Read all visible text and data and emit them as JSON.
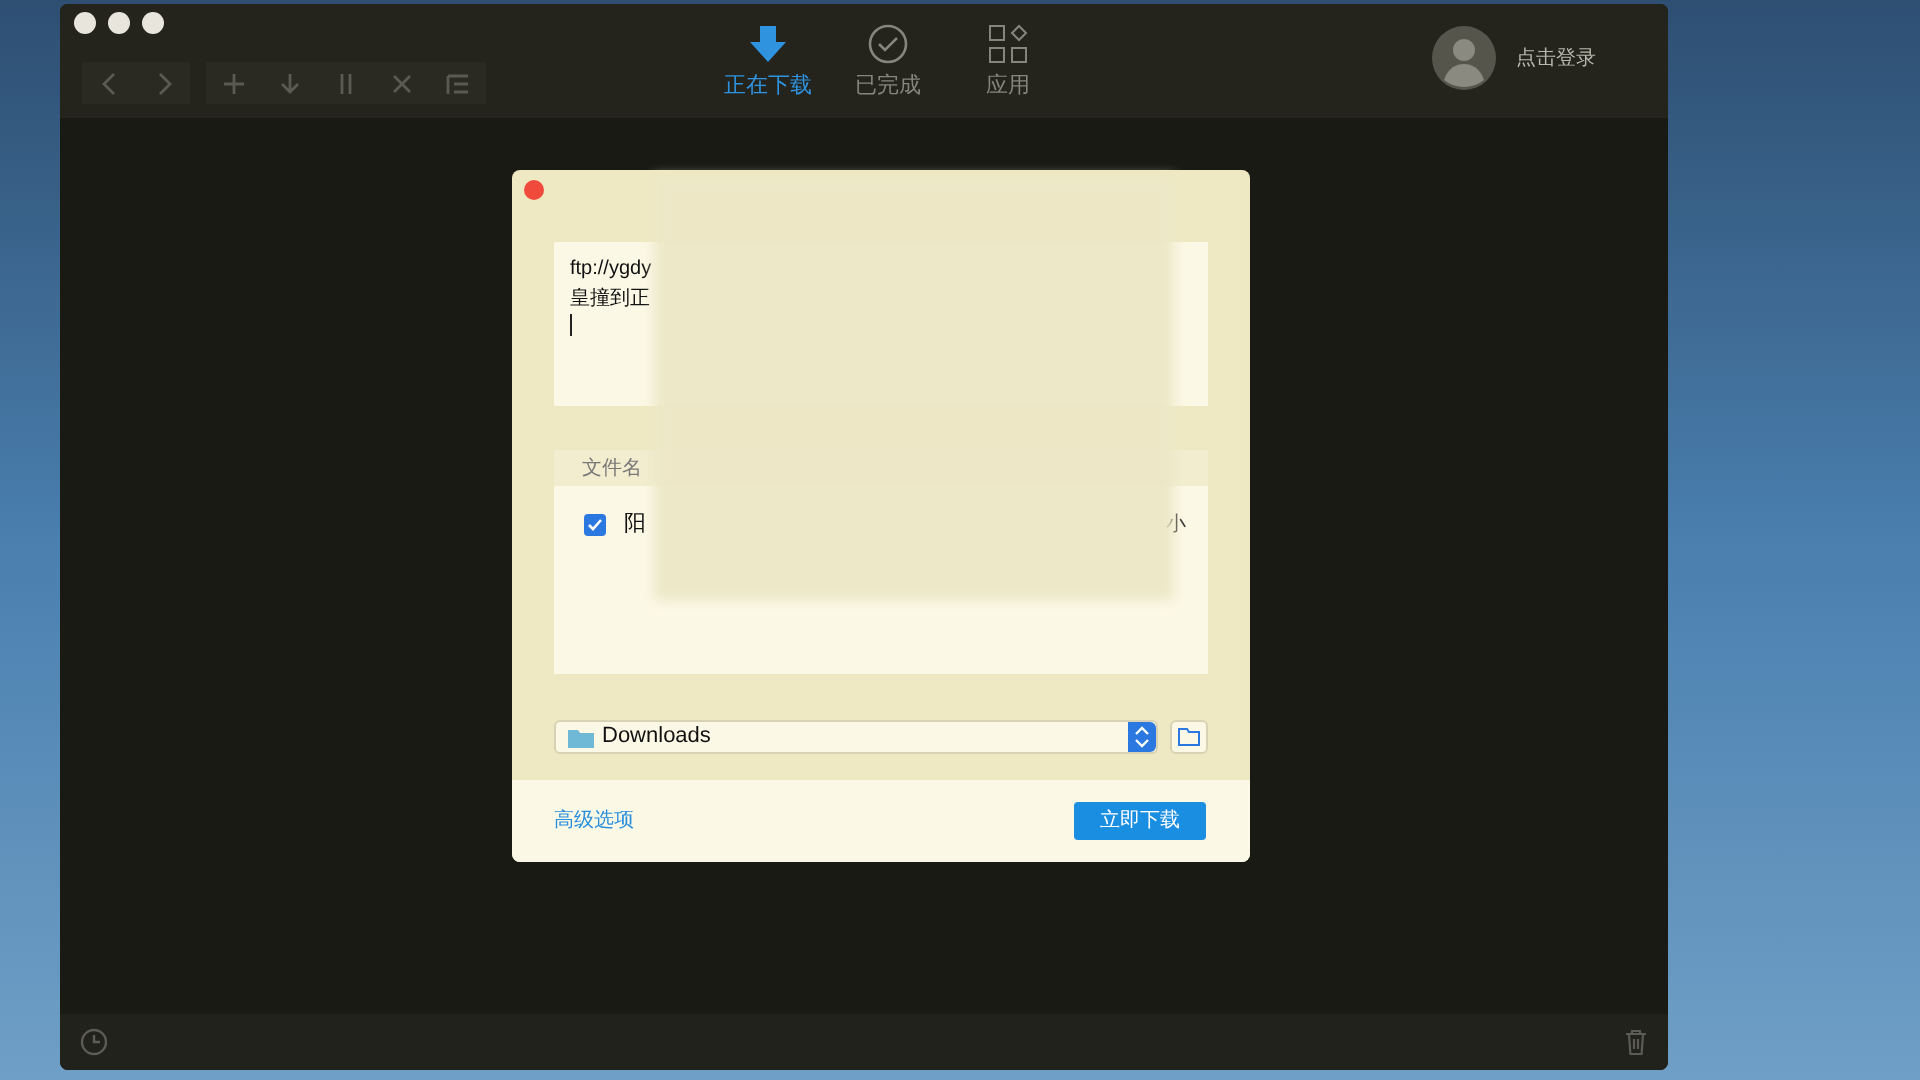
{
  "tabs": [
    {
      "kind": "downloading",
      "label": "正在下载",
      "selected": true
    },
    {
      "kind": "completed",
      "label": "已完成",
      "selected": false
    },
    {
      "kind": "apps",
      "label": "应用",
      "selected": false
    }
  ],
  "account": {
    "label": "点击登录"
  },
  "dialog": {
    "url_lines": [
      "ftp://ygdy",
      "皇撞到正"
    ],
    "file_list": {
      "column": "文件名",
      "rows": [
        {
          "name": "阳",
          "column_2": "小",
          "checked": true
        }
      ]
    },
    "folder": {
      "value": "Downloads"
    },
    "advanced_link": "高级选项",
    "primary_button": "立即下载"
  }
}
